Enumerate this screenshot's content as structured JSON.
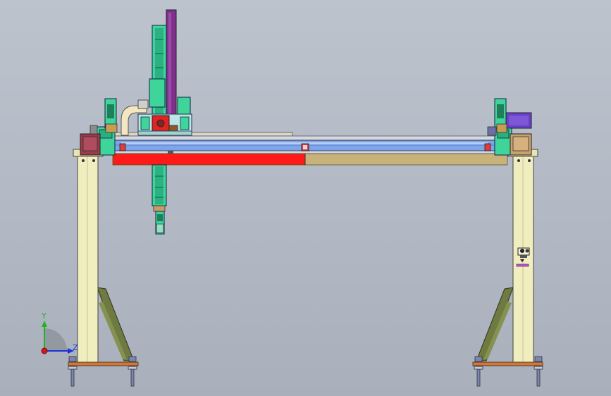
{
  "viewport": {
    "background_top": "#bcc3cd",
    "background_bottom": "#a9b0bc"
  },
  "triad": {
    "y_label": "Y",
    "z_label": "Z",
    "y_color": "#1fb51f",
    "z_color": "#1b33d6",
    "origin_color": "#d21818"
  },
  "colors": {
    "leg": "#f0edbf",
    "brace": "#6e7a41",
    "beam_blue": "#7da6ea",
    "rail_light": "#d5d7e2",
    "red_rail": "#ff1a1a",
    "tan_rail": "#c8b27a",
    "green": "#3fd59a",
    "purple": "#80308a",
    "base_plate": "#d9752c",
    "bolt": "#7a86b4"
  }
}
